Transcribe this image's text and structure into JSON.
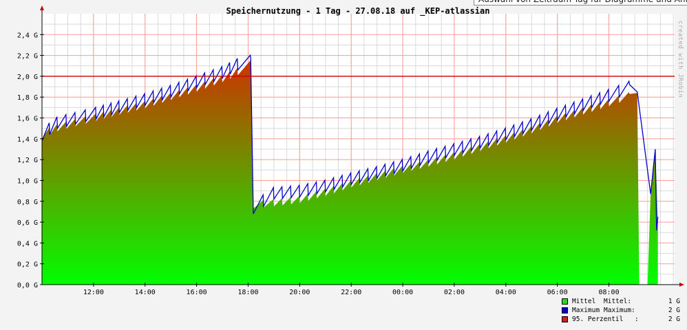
{
  "tooltip": "Auswahl von Zeitraum Tag für Diagramme und Anfragestatistik",
  "chart_data": {
    "type": "area",
    "title": "Speichernutzung - 1 Tag - 27.08.18 auf _KEP-atlassian",
    "watermark": "created with JRobin",
    "xlabel": "",
    "ylabel": "",
    "ylim": [
      0,
      2.6
    ],
    "y_ticks": [
      {
        "value": 0.0,
        "label": "0,0 G"
      },
      {
        "value": 0.2,
        "label": "0,2 G"
      },
      {
        "value": 0.4,
        "label": "0,4 G"
      },
      {
        "value": 0.6,
        "label": "0,6 G"
      },
      {
        "value": 0.8,
        "label": "0,8 G"
      },
      {
        "value": 1.0,
        "label": "1,0 G"
      },
      {
        "value": 1.2,
        "label": "1,2 G"
      },
      {
        "value": 1.4,
        "label": "1,4 G"
      },
      {
        "value": 1.6,
        "label": "1,6 G"
      },
      {
        "value": 1.8,
        "label": "1,8 G"
      },
      {
        "value": 2.0,
        "label": "2,0 G"
      },
      {
        "value": 2.2,
        "label": "2,2 G"
      },
      {
        "value": 2.4,
        "label": "2,4 G"
      }
    ],
    "x_range_hours": [
      10.0,
      34.55
    ],
    "x_ticks": [
      {
        "hour": 12,
        "label": "12:00"
      },
      {
        "hour": 14,
        "label": "14:00"
      },
      {
        "hour": 16,
        "label": "16:00"
      },
      {
        "hour": 18,
        "label": "18:00"
      },
      {
        "hour": 20,
        "label": "20:00"
      },
      {
        "hour": 22,
        "label": "22:00"
      },
      {
        "hour": 24,
        "label": "00:00"
      },
      {
        "hour": 26,
        "label": "02:00"
      },
      {
        "hour": 28,
        "label": "04:00"
      },
      {
        "hour": 30,
        "label": "06:00"
      },
      {
        "hour": 32,
        "label": "08:00"
      }
    ],
    "percentile_95": 2.0,
    "series": [
      {
        "name": "Mittel",
        "x_hours": [
          10.0,
          10.6,
          11.3,
          12.1,
          13.0,
          14.0,
          15.0,
          16.0,
          17.0,
          17.6,
          18.1,
          18.2,
          19.0,
          20.0,
          21.0,
          22.0,
          23.0,
          24.0,
          25.0,
          26.0,
          27.0,
          28.0,
          29.0,
          30.0,
          31.0,
          32.0,
          32.8,
          33.1,
          33.18,
          33.5,
          33.62,
          33.7,
          33.8,
          33.9
        ],
        "values": [
          1.45,
          1.52,
          1.57,
          1.62,
          1.68,
          1.74,
          1.82,
          1.9,
          1.99,
          2.06,
          2.13,
          0.78,
          0.8,
          0.83,
          0.9,
          0.98,
          1.05,
          1.12,
          1.18,
          1.25,
          1.33,
          1.41,
          1.5,
          1.6,
          1.68,
          1.76,
          1.83,
          1.84,
          0.0,
          0.0,
          0.88,
          1.1,
          1.3,
          0.62
        ]
      },
      {
        "name": "Maximum",
        "x_hours": [
          10.0,
          10.6,
          11.3,
          12.1,
          13.0,
          14.0,
          15.0,
          16.0,
          17.0,
          17.6,
          18.1,
          18.2,
          19.0,
          20.0,
          21.0,
          22.0,
          23.0,
          24.0,
          25.0,
          26.0,
          27.0,
          28.0,
          29.0,
          30.0,
          31.0,
          32.0,
          32.8,
          33.1,
          33.62,
          33.8,
          33.85,
          33.9
        ],
        "values": [
          1.46,
          1.58,
          1.62,
          1.67,
          1.73,
          1.8,
          1.88,
          1.97,
          2.06,
          2.14,
          2.17,
          0.76,
          0.9,
          0.92,
          0.97,
          1.04,
          1.1,
          1.17,
          1.25,
          1.32,
          1.39,
          1.47,
          1.56,
          1.66,
          1.75,
          1.84,
          1.92,
          1.85,
          0.87,
          1.3,
          0.52,
          0.65
        ]
      }
    ],
    "legend": [
      {
        "name": "Mittel",
        "stat": "Mittel:",
        "value": "1 G",
        "color": "#22dd22"
      },
      {
        "name": "Maximum",
        "stat": "Maximum:",
        "value": "2 G",
        "color": "#0000cc"
      },
      {
        "name": "95. Perzentil",
        "stat": ":",
        "value": "2 G",
        "color": "#cc2222"
      }
    ],
    "colors": {
      "area_top": "#cc3300",
      "area_bottom": "#00ff00",
      "max_line": "#0000cc",
      "percentile_line": "#cc0000",
      "grid_major": "#ff9999",
      "grid_minor": "#d9d9d9",
      "plot_bg": "#ffffff"
    }
  }
}
